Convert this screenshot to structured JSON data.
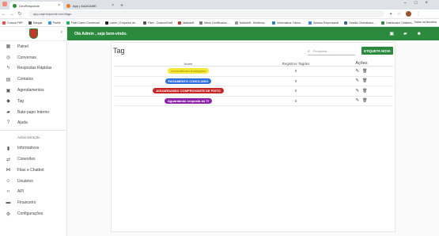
{
  "browser": {
    "tabs": [
      {
        "label": "GeoResponde",
        "active": true,
        "color": "#2b8a3e"
      },
      {
        "label": "App | AAAGAME",
        "active": false,
        "color": "#e67e22"
      }
    ],
    "url": "app.zapresponde.com/tags",
    "bookmarks": [
      "Cursos PHP",
      "Hangar",
      "Profile",
      "Fidel Carrio Comercial",
      "Leiner | Empresa de...",
      "Files - CodeonShell",
      "Markdoff",
      "Meus Certificados...",
      "Markdoff - Multimos...",
      "Informática: Dicion...",
      "Acesso Empresarial",
      "Gestão Cheirabaco...",
      "Dashboard | Makera..."
    ],
    "bookmarks_right": "Todos os favoritos"
  },
  "sidebar": {
    "items": [
      {
        "label": "Painel",
        "icon": "dashboard-icon",
        "glyph": "▦"
      },
      {
        "label": "Conversas",
        "icon": "whatsapp-icon",
        "glyph": "◎"
      },
      {
        "label": "Respostas Rápidas",
        "icon": "flash-icon",
        "glyph": "ϟ"
      },
      {
        "label": "Contatos",
        "icon": "contacts-icon",
        "glyph": "▤"
      },
      {
        "label": "Agendamentos",
        "icon": "calendar-icon",
        "glyph": "▣"
      },
      {
        "label": "Tag",
        "icon": "tag-icon",
        "glyph": "◆"
      },
      {
        "label": "Bate-papo Interno",
        "icon": "chat-icon",
        "glyph": "▰"
      },
      {
        "label": "Ajuda",
        "icon": "help-icon",
        "glyph": "?"
      }
    ],
    "admin_heading": "Administração",
    "admin_items": [
      {
        "label": "Informativos",
        "icon": "announcement-icon",
        "glyph": "▮"
      },
      {
        "label": "Conexões",
        "icon": "sync-icon",
        "glyph": "⇄"
      },
      {
        "label": "Filas e Chatbot",
        "icon": "queue-icon",
        "glyph": "⋈"
      },
      {
        "label": "Usuários",
        "icon": "users-icon",
        "glyph": "☺"
      },
      {
        "label": "API",
        "icon": "code-icon",
        "glyph": "‹›"
      },
      {
        "label": "Financeiro",
        "icon": "money-icon",
        "glyph": "▬"
      },
      {
        "label": "Configurações",
        "icon": "settings-icon",
        "glyph": "⚙"
      }
    ]
  },
  "topbar": {
    "greeting": "Olá Admin , seja bem-vindo."
  },
  "page": {
    "title": "Tag",
    "search_placeholder": "Pesquisar...",
    "new_button": "ETIQUETA NOVA",
    "columns": [
      "Nome",
      "Registros Tagdes",
      "Ações"
    ],
    "rows": [
      {
        "name": "consultando Instagram",
        "count": "0",
        "bg": "#f5e63a",
        "fg": "#b8a500"
      },
      {
        "name": "PAGAMENTO CONCLUIDO",
        "count": "0",
        "bg": "#2f6fe0",
        "fg": "#ffffff"
      },
      {
        "name": "AGUARDANDO COMPROVANTE DE PIXTO",
        "count": "0",
        "bg": "#c62828",
        "fg": "#ffffff"
      },
      {
        "name": "Aguardando resposta do Ti",
        "count": "0",
        "bg": "#8e24aa",
        "fg": "#ffffff"
      }
    ]
  }
}
